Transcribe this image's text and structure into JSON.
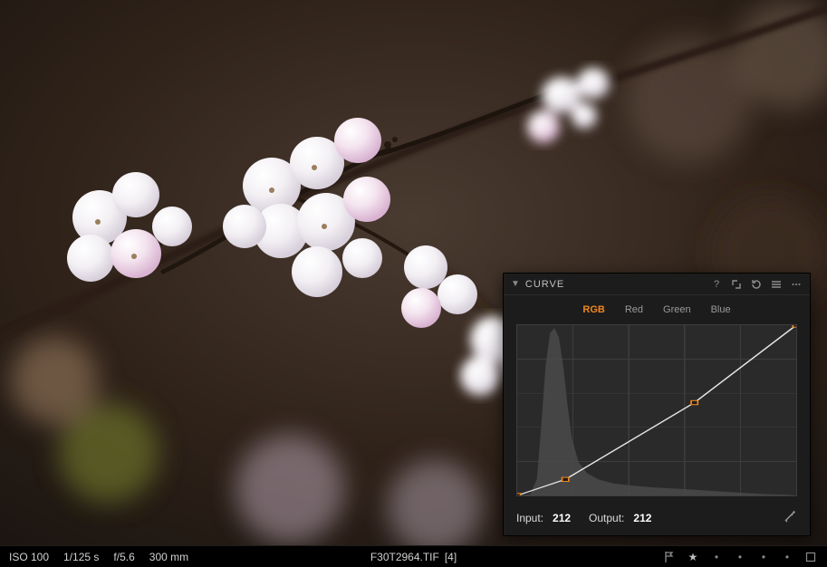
{
  "curve_panel": {
    "title": "CURVE",
    "channels": {
      "rgb": "RGB",
      "red": "Red",
      "green": "Green",
      "blue": "Blue"
    },
    "active_channel": "RGB",
    "input_label": "Input:",
    "input_value": "212",
    "output_label": "Output:",
    "output_value": "212",
    "points": [
      {
        "in": 0,
        "out": 0
      },
      {
        "in": 44,
        "out": 24
      },
      {
        "in": 162,
        "out": 139
      },
      {
        "in": 255,
        "out": 255
      }
    ]
  },
  "metadata": {
    "iso": "ISO 100",
    "shutter": "1/125 s",
    "aperture": "f/5.6",
    "focal_length": "300 mm",
    "filename": "F30T2964.TIF",
    "sequence": "[4]"
  }
}
